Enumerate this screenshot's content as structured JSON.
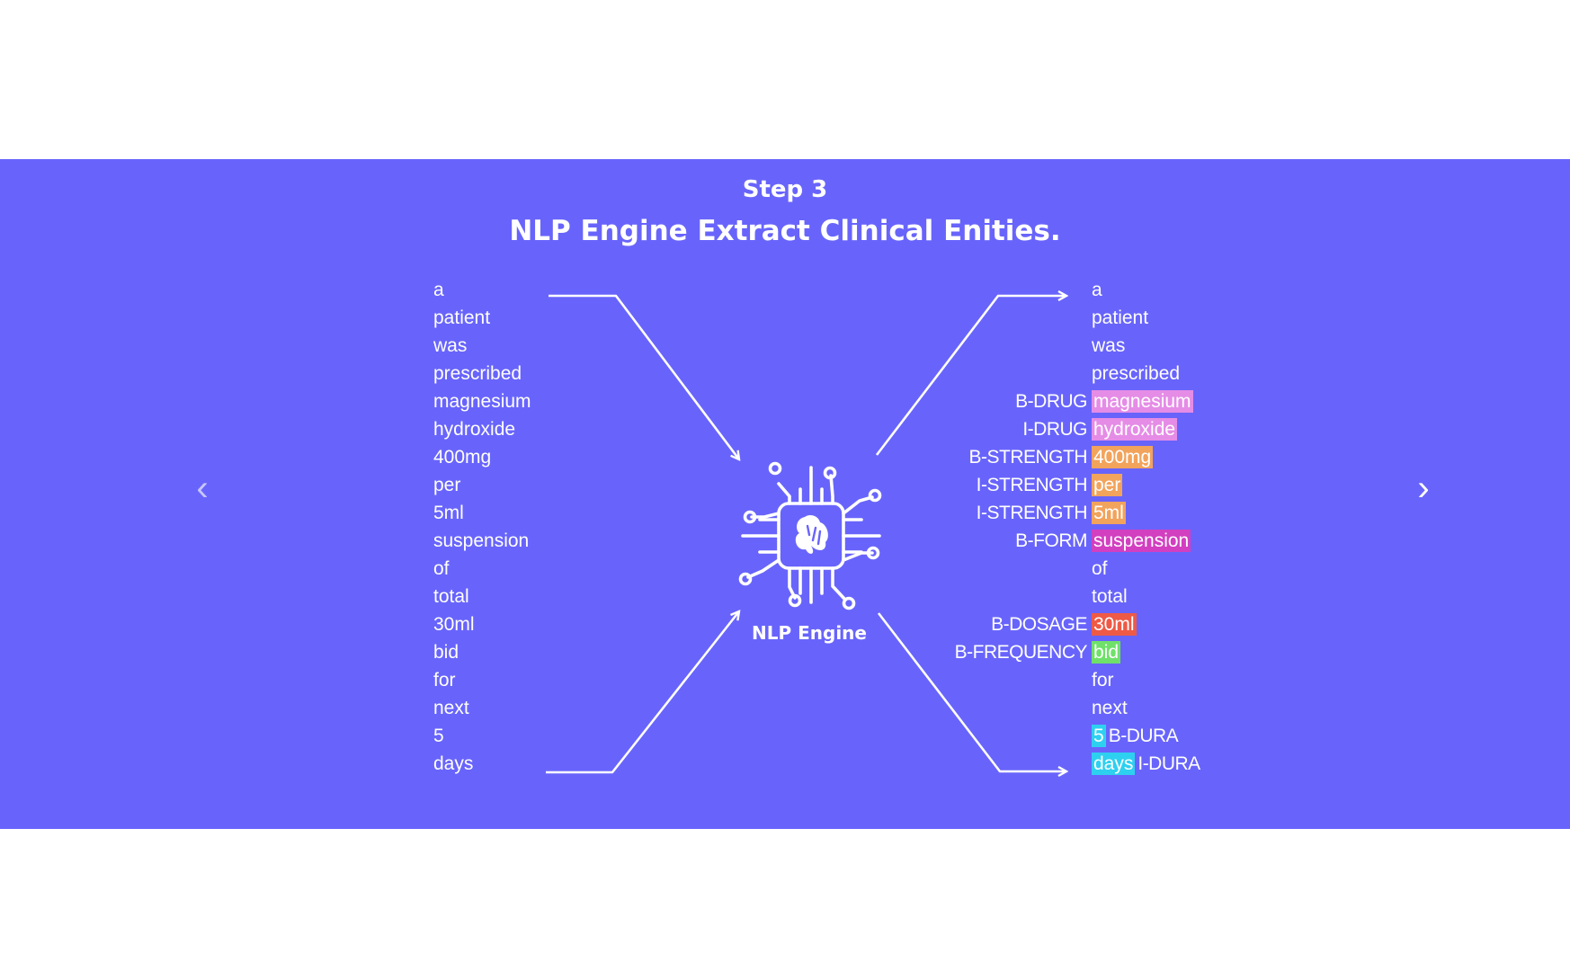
{
  "header": {
    "step": "Step 3",
    "title": "NLP Engine Extract Clinical Enities."
  },
  "engine": {
    "label": "NLP Engine",
    "icon": "brain-chip-icon"
  },
  "nav": {
    "prev_icon": "chevron-left-icon",
    "next_icon": "chevron-right-icon",
    "prev_glyph": "‹",
    "next_glyph": "›"
  },
  "colors": {
    "band": "#6864fb",
    "drug": "#e58ce6",
    "strength": "#f2a35c",
    "form": "#d23fc0",
    "dosage": "#ee5a45",
    "frequency": "#6fe06a",
    "duration": "#2ed0f0"
  },
  "input_words": [
    "a",
    "patient",
    "was",
    "prescribed",
    "magnesium",
    "hydroxide",
    "400mg",
    "per",
    "5ml",
    "suspension",
    "of",
    "total",
    "30ml",
    "bid",
    "for",
    "next",
    "5",
    "days"
  ],
  "output_rows": [
    {
      "word": "a",
      "tag": "",
      "tag_side": "",
      "color": ""
    },
    {
      "word": "patient",
      "tag": "",
      "tag_side": "",
      "color": ""
    },
    {
      "word": "was",
      "tag": "",
      "tag_side": "",
      "color": ""
    },
    {
      "word": "prescribed",
      "tag": "",
      "tag_side": "",
      "color": ""
    },
    {
      "word": "magnesium",
      "tag": "B-DRUG",
      "tag_side": "left",
      "color": "#e58ce6"
    },
    {
      "word": "hydroxide",
      "tag": "I-DRUG",
      "tag_side": "left",
      "color": "#e58ce6"
    },
    {
      "word": "400mg",
      "tag": "B-STRENGTH",
      "tag_side": "left",
      "color": "#f2a35c"
    },
    {
      "word": "per",
      "tag": "I-STRENGTH",
      "tag_side": "left",
      "color": "#f2a35c"
    },
    {
      "word": "5ml",
      "tag": "I-STRENGTH",
      "tag_side": "left",
      "color": "#f2a35c"
    },
    {
      "word": "suspension",
      "tag": "B-FORM",
      "tag_side": "left",
      "color": "#d23fc0"
    },
    {
      "word": "of",
      "tag": "",
      "tag_side": "",
      "color": ""
    },
    {
      "word": "total",
      "tag": "",
      "tag_side": "",
      "color": ""
    },
    {
      "word": "30ml",
      "tag": "B-DOSAGE",
      "tag_side": "left",
      "color": "#ee5a45"
    },
    {
      "word": "bid",
      "tag": "B-FREQUENCY",
      "tag_side": "left",
      "color": "#6fe06a"
    },
    {
      "word": "for",
      "tag": "",
      "tag_side": "",
      "color": ""
    },
    {
      "word": "next",
      "tag": "",
      "tag_side": "",
      "color": ""
    },
    {
      "word": "5",
      "tag": "B-DURA",
      "tag_side": "right",
      "color": "#2ed0f0"
    },
    {
      "word": "days",
      "tag": "I-DURA",
      "tag_side": "right",
      "color": "#2ed0f0"
    }
  ]
}
